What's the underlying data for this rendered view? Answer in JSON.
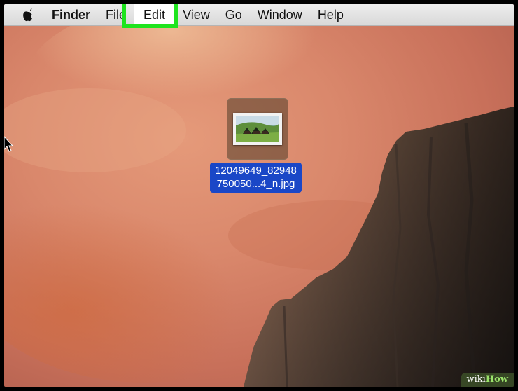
{
  "menubar": {
    "app_name": "Finder",
    "items": [
      "File",
      "Edit",
      "View",
      "Go",
      "Window",
      "Help"
    ],
    "highlighted_item": "Edit",
    "highlight_color": "#1ee41e"
  },
  "desktop": {
    "file": {
      "name_line1": "12049649_82948",
      "name_line2": "750050...4_n.jpg",
      "selection_color": "#1a47c7"
    }
  },
  "watermark": {
    "part1": "wiki",
    "part2": "How"
  },
  "icons": {
    "apple": "apple-logo-icon",
    "cursor": "mouse-pointer-icon",
    "file": "image-file-icon"
  }
}
